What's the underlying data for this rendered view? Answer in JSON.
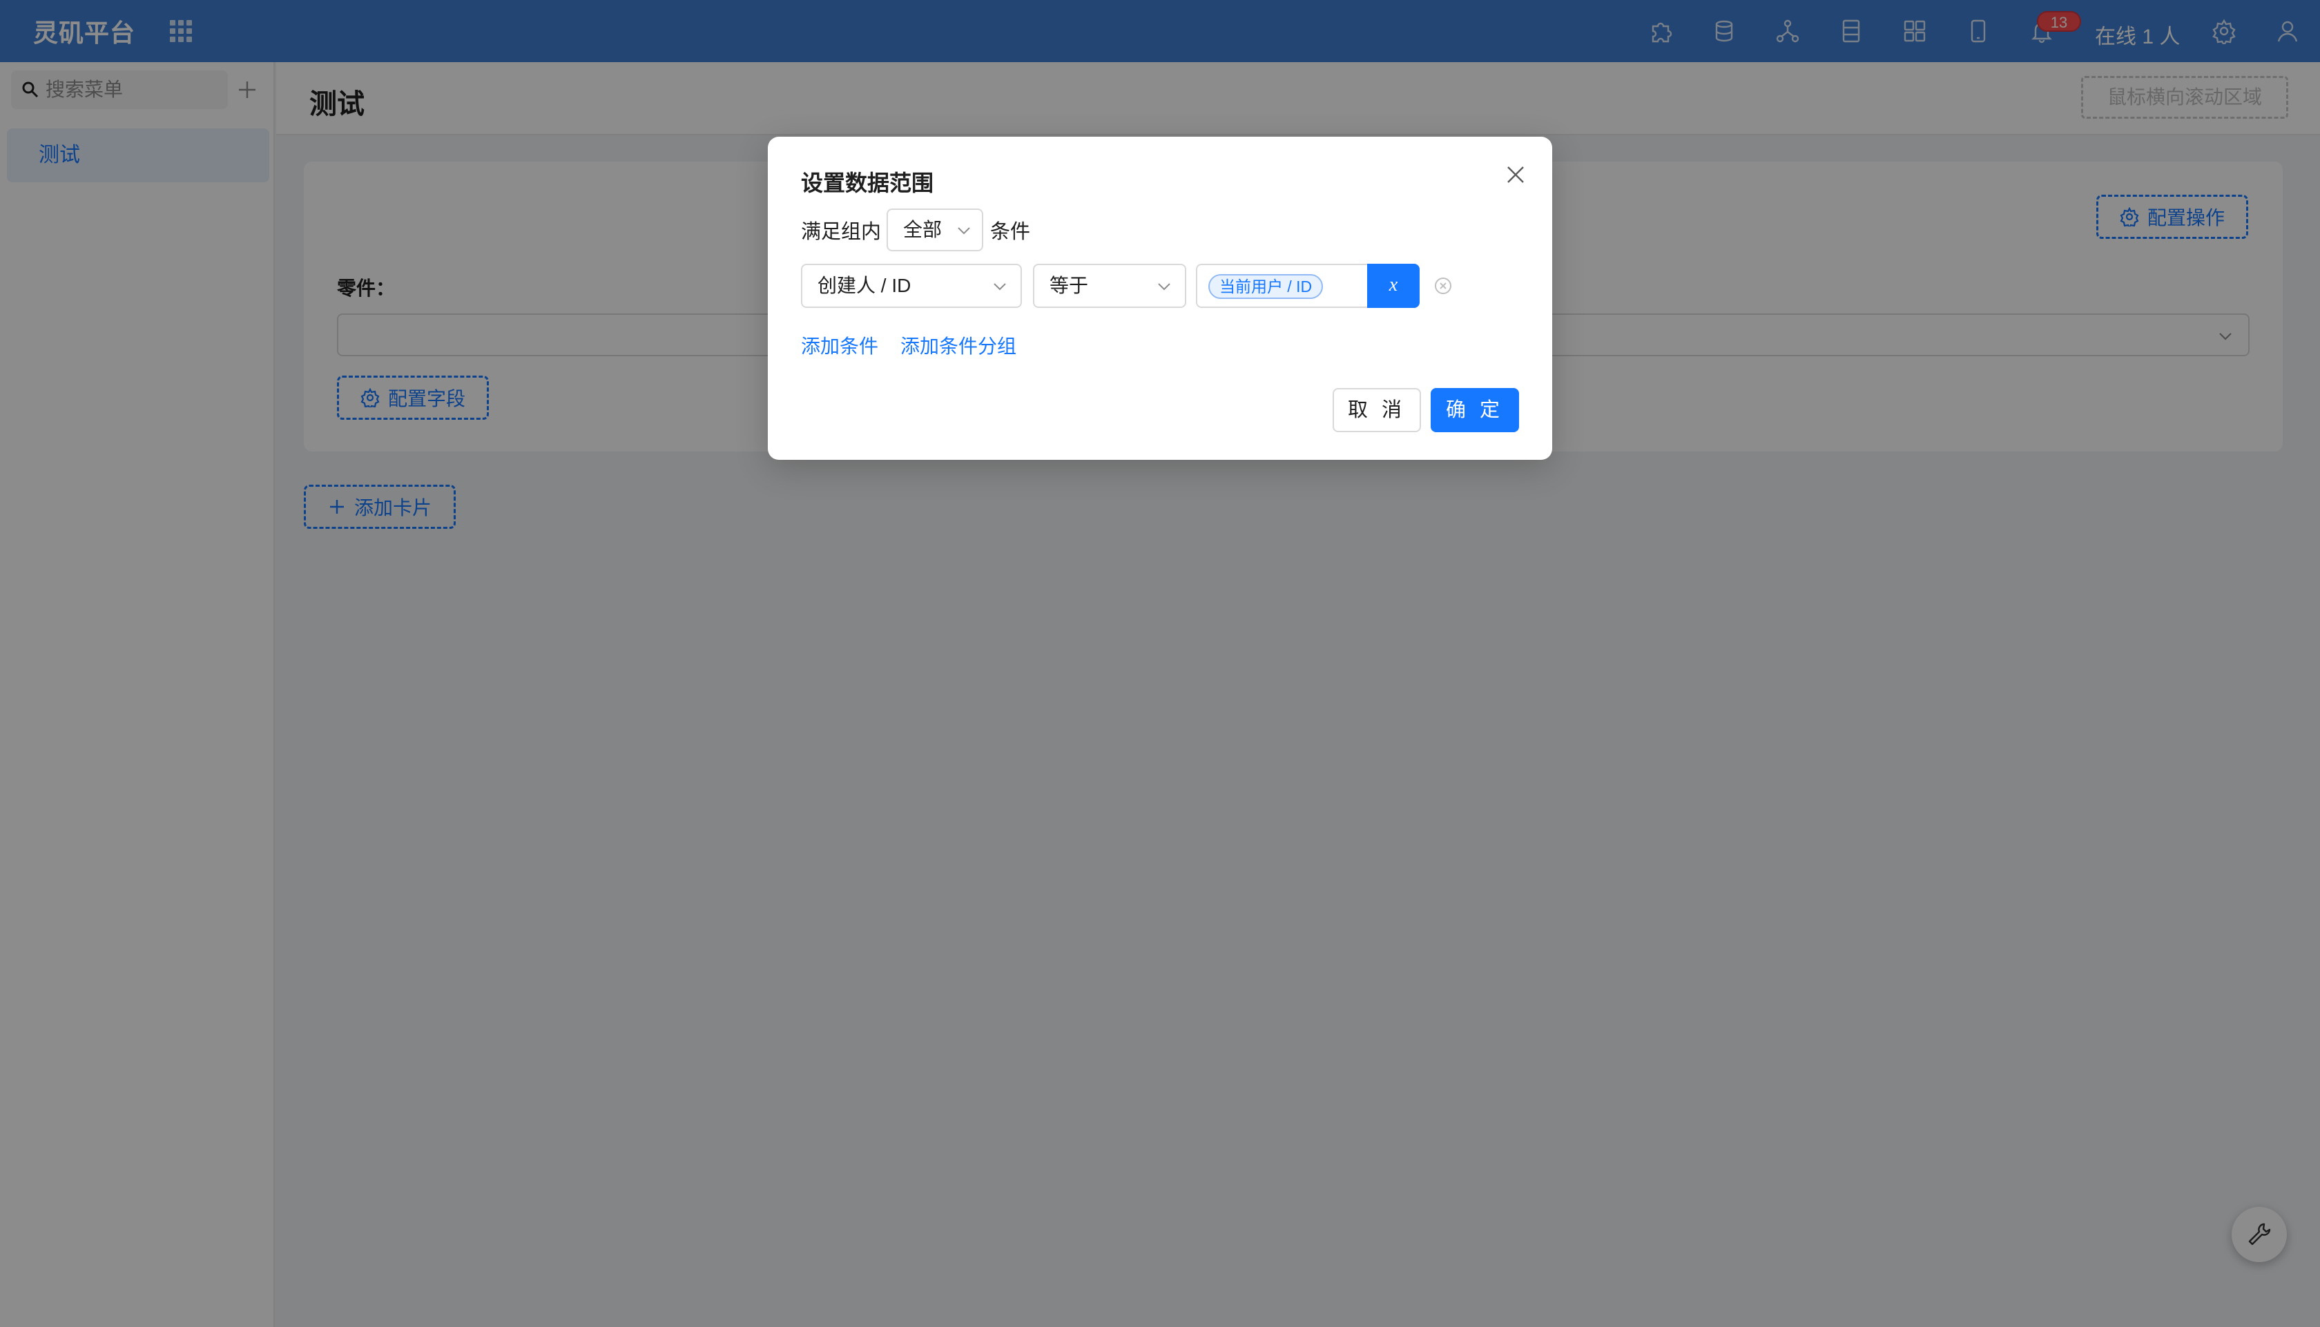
{
  "topbar": {
    "brand": "灵矶平台",
    "icons": [
      "apps-grid-icon",
      "puzzle-icon",
      "database-icon",
      "flow-icon",
      "sheet-icon",
      "dashboard-icon",
      "mobile-icon",
      "bell-icon",
      "gear-icon",
      "user-icon"
    ],
    "notification_count": "13",
    "online_text": "在线 1 人"
  },
  "sidebar": {
    "search_placeholder": "搜索菜单",
    "items": [
      {
        "label": "测试"
      }
    ]
  },
  "page": {
    "title": "测试",
    "scroll_area_label": "鼠标横向滚动区域",
    "config_operation_label": "配置操作",
    "field_label": "零件：",
    "config_field_label": "配置字段",
    "add_card_label": "添加卡片"
  },
  "modal": {
    "title": "设置数据范围",
    "match_prefix": "满足组内",
    "match_value": "全部",
    "match_suffix": "条件",
    "condition": {
      "field": "创建人 / ID",
      "operator": "等于",
      "value_tag": "当前用户 / ID",
      "variable_button": "x"
    },
    "add_condition": "添加条件",
    "add_condition_group": "添加条件分组",
    "cancel": "取 消",
    "confirm": "确 定"
  },
  "colors": {
    "topbar": "#3f7fd2",
    "primary": "#1677ff",
    "badge": "#ff4d4f"
  }
}
